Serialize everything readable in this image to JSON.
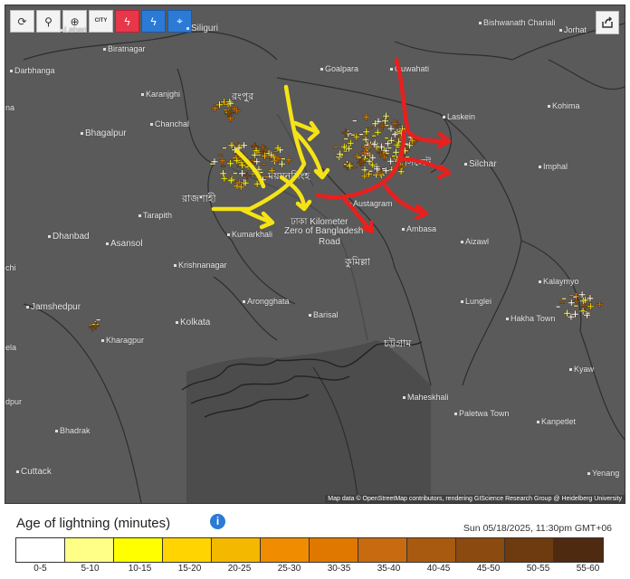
{
  "toolbar": {
    "items": [
      {
        "name": "refresh-icon",
        "glyph": "⟳"
      },
      {
        "name": "location-pin-icon",
        "glyph": "⚲"
      },
      {
        "name": "zoom-icon",
        "glyph": "⊕"
      },
      {
        "name": "city-layer-icon",
        "glyph": "CITY"
      },
      {
        "name": "lightning-red-icon",
        "glyph": "ϟ"
      },
      {
        "name": "lightning-blue-icon",
        "glyph": "ϟ"
      },
      {
        "name": "satellite-icon",
        "glyph": "⌖"
      }
    ]
  },
  "map": {
    "places": [
      {
        "name": "Siliguri",
        "cls": "big"
      },
      {
        "name": "Lahan",
        "cls": ""
      },
      {
        "name": "Biratnagar",
        "cls": ""
      },
      {
        "name": "Darbhanga",
        "cls": ""
      },
      {
        "name": "na",
        "cls": ""
      },
      {
        "name": "Karanjghi",
        "cls": ""
      },
      {
        "name": "Chanchal",
        "cls": ""
      },
      {
        "name": "Bhagalpur",
        "cls": "big"
      },
      {
        "name": "Goalpara",
        "cls": ""
      },
      {
        "name": "Guwahati",
        "cls": ""
      },
      {
        "name": "Bishwanath Chariali",
        "cls": ""
      },
      {
        "name": "Jorhat",
        "cls": ""
      },
      {
        "name": "Laskein",
        "cls": ""
      },
      {
        "name": "Kohima",
        "cls": ""
      },
      {
        "name": "Silchar",
        "cls": "big"
      },
      {
        "name": "Imphal",
        "cls": ""
      },
      {
        "name": "Tarapith",
        "cls": ""
      },
      {
        "name": "Dhanbad",
        "cls": "big"
      },
      {
        "name": "Asansol",
        "cls": "big"
      },
      {
        "name": "Kumarkhali",
        "cls": ""
      },
      {
        "name": "Austagram",
        "cls": ""
      },
      {
        "name": "Ambasa",
        "cls": ""
      },
      {
        "name": "Aizawl",
        "cls": ""
      },
      {
        "name": "Krishnanagar",
        "cls": ""
      },
      {
        "name": "Kalaymyo",
        "cls": ""
      },
      {
        "name": "Lunglei",
        "cls": ""
      },
      {
        "name": "Jamshedpur",
        "cls": "big"
      },
      {
        "name": "Kolkata",
        "cls": "big"
      },
      {
        "name": "Arongghata",
        "cls": ""
      },
      {
        "name": "Barisal",
        "cls": ""
      },
      {
        "name": "Hakha Town",
        "cls": ""
      },
      {
        "name": "Kharagpur",
        "cls": ""
      },
      {
        "name": "ela",
        "cls": ""
      },
      {
        "name": "Kyaw",
        "cls": ""
      },
      {
        "name": "Maheskhali",
        "cls": ""
      },
      {
        "name": "Paletwa Town",
        "cls": ""
      },
      {
        "name": "Kanpetlet",
        "cls": ""
      },
      {
        "name": "Bhadrak",
        "cls": ""
      },
      {
        "name": "Cuttack",
        "cls": "big"
      },
      {
        "name": "Yenang",
        "cls": ""
      },
      {
        "name": "dpur",
        "cls": ""
      },
      {
        "name": "chi",
        "cls": ""
      },
      {
        "name": "ঢাকা Kilometer",
        "cls": "big"
      },
      {
        "name": "Zero of Bangladesh",
        "cls": "big"
      },
      {
        "name": "Road",
        "cls": "big"
      },
      {
        "name": "কুমিল্লা",
        "cls": "bold"
      },
      {
        "name": "চট্টগ্রাম",
        "cls": "bold"
      },
      {
        "name": "রংপুর",
        "cls": "bold"
      },
      {
        "name": "রাজশাহী",
        "cls": "bold"
      },
      {
        "name": "সিলেট",
        "cls": "bold"
      },
      {
        "name": "ময়মনসিংহ",
        "cls": "bold"
      }
    ],
    "attribution": "Map data © OpenStreetMap contributors, rendering GIScience Research Group @ Heidelberg University"
  },
  "legend": {
    "title": "Age of lightning (minutes)",
    "timestamp": "Sun 05/18/2025, 11:30pm GMT+06",
    "bins": [
      {
        "label": "0-5",
        "color": "#ffffff"
      },
      {
        "label": "5-10",
        "color": "#ffff88"
      },
      {
        "label": "10-15",
        "color": "#ffff00"
      },
      {
        "label": "15-20",
        "color": "#ffd400"
      },
      {
        "label": "20-25",
        "color": "#f5b800"
      },
      {
        "label": "25-30",
        "color": "#f08c00"
      },
      {
        "label": "30-35",
        "color": "#e07800"
      },
      {
        "label": "35-40",
        "color": "#c86a10"
      },
      {
        "label": "40-45",
        "color": "#a85a10"
      },
      {
        "label": "45-50",
        "color": "#8a4a10"
      },
      {
        "label": "50-55",
        "color": "#6e3a10"
      },
      {
        "label": "55-60",
        "color": "#4e2a10"
      }
    ]
  },
  "colors": {
    "annotation_yellow": "#f5e316",
    "annotation_red": "#e8201e",
    "land": "#5a5a5a"
  }
}
